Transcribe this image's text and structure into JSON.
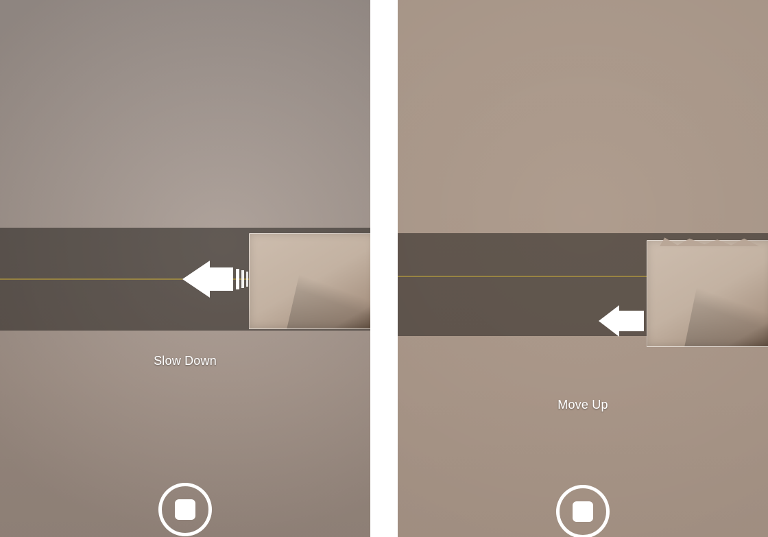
{
  "panels": {
    "left": {
      "hint": "Slow Down",
      "arrow_icon": "arrow-left-trail"
    },
    "right": {
      "hint": "Move Up",
      "arrow_icon": "arrow-left"
    }
  }
}
